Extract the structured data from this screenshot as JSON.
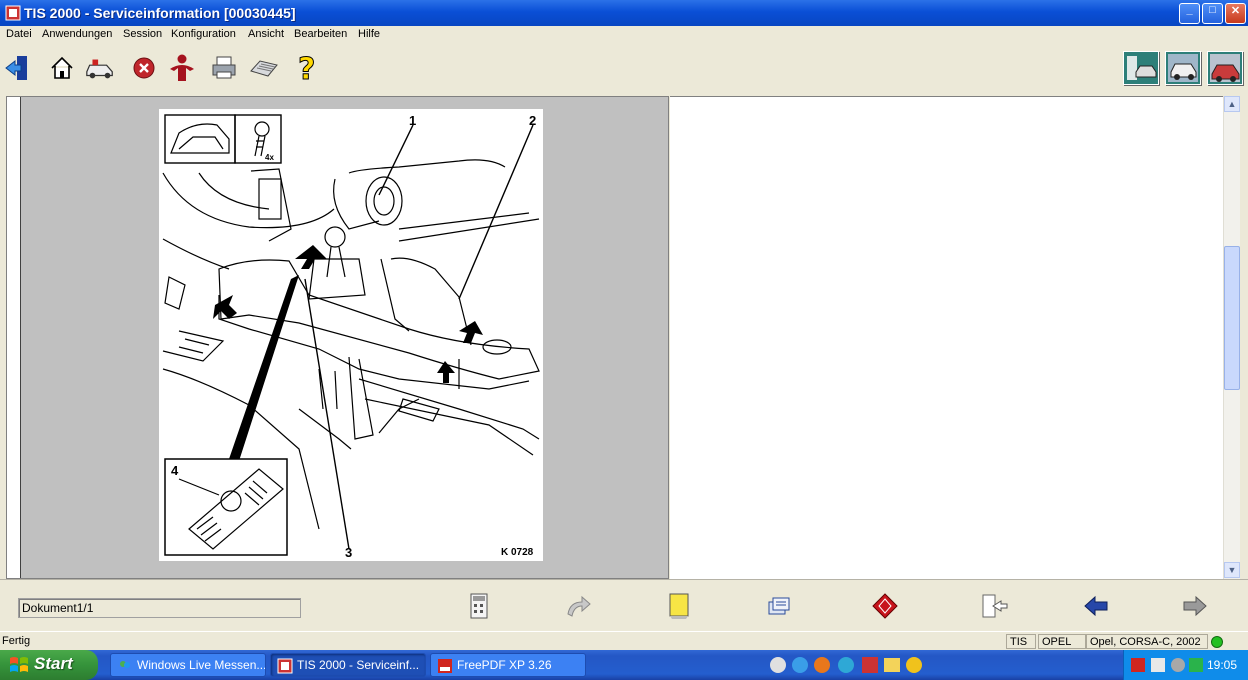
{
  "window": {
    "title": "TIS 2000 - Serviceinformation [00030445]",
    "controls": {
      "minimize": "_",
      "maximize": "□",
      "close": "✕"
    }
  },
  "menu": {
    "items": [
      "Datei",
      "Anwendungen",
      "Session",
      "Konfiguration",
      "Ansicht",
      "Bearbeiten",
      "Hilfe"
    ]
  },
  "toolbar": {
    "icons": [
      "exit-icon",
      "home-icon",
      "vehicle-selection-icon",
      "stop-icon",
      "person-icon",
      "print-icon",
      "keyboard-icon",
      "help-icon"
    ],
    "right_icons": [
      "diagnostic-vehicle-icon",
      "service-vehicle-icon",
      "repair-vehicle-icon"
    ]
  },
  "figure": {
    "callouts": [
      "1",
      "2",
      "3",
      "4"
    ],
    "ref_code": "K 0728",
    "inset_count": "4x"
  },
  "bottom": {
    "document_label": "Dokument1/1",
    "buttons": [
      "calculator-icon",
      "redo-icon",
      "notes-icon",
      "documents-icon",
      "navigation-icon",
      "exit-doc-icon",
      "back-icon",
      "forward-icon"
    ]
  },
  "status": {
    "left": "Fertig",
    "app": "TIS",
    "brand": "OPEL",
    "vehicle": "Opel, CORSA-C, 2002",
    "indicator_color": "#22c022"
  },
  "taskbar": {
    "start_label": "Start",
    "tasks": [
      {
        "label": "Windows Live Messen...",
        "icon": "messenger-icon"
      },
      {
        "label": "TIS 2000 - Serviceinf...",
        "icon": "tis-icon"
      },
      {
        "label": "FreePDF XP 3.26",
        "icon": "pdf-icon"
      }
    ],
    "clock": "19:05"
  }
}
